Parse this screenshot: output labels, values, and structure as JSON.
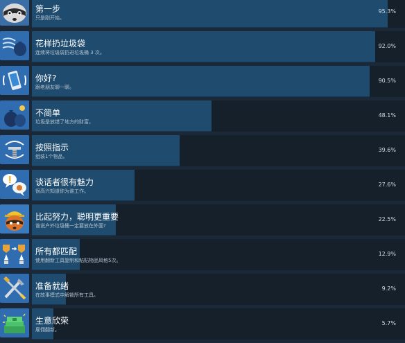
{
  "achievements": [
    {
      "title": "第一步",
      "desc": "只是刚开始。",
      "percent_label": "95.3%",
      "percent": 95.3,
      "icon": "raccoon-icon"
    },
    {
      "title": "花样扔垃圾袋",
      "desc": "连续将垃圾袋扔进垃圾桶 3 次。",
      "percent_label": "92.0%",
      "percent": 92.0,
      "icon": "trash-bag-throw-icon"
    },
    {
      "title": "你好?",
      "desc": "跟老朋友聊一聊。",
      "percent_label": "90.5%",
      "percent": 90.5,
      "icon": "phone-icon"
    },
    {
      "title": "不简单",
      "desc": "垃圾是放错了地方的财富。",
      "percent_label": "48.1%",
      "percent": 48.1,
      "icon": "trash-bag-icon"
    },
    {
      "title": "按照指示",
      "desc": "组装1个物品。",
      "percent_label": "39.6%",
      "percent": 39.6,
      "icon": "screw-icon"
    },
    {
      "title": "谈话者很有魅力",
      "desc": "很高兴知道你为谁工作。",
      "percent_label": "27.6%",
      "percent": 27.6,
      "icon": "speech-bubble-icon"
    },
    {
      "title": "比起努力，聪明更重要",
      "desc": "谁说户外垃圾桶一定要放在外面?",
      "percent_label": "22.5%",
      "percent": 22.5,
      "icon": "worker-raccoon-icon"
    },
    {
      "title": "所有都匹配",
      "desc": "使用翻新工具复制和粘贴物品风格5次。",
      "percent_label": "12.9%",
      "percent": 12.9,
      "icon": "paint-match-icon"
    },
    {
      "title": "准备就绪",
      "desc": "在故事模式中解锁所有工具。",
      "percent_label": "9.2%",
      "percent": 9.2,
      "icon": "tools-icon"
    },
    {
      "title": "生意欣荣",
      "desc": "雇佣翻新。",
      "percent_label": "5.7%",
      "percent": 5.7,
      "icon": "money-stack-icon"
    }
  ]
}
